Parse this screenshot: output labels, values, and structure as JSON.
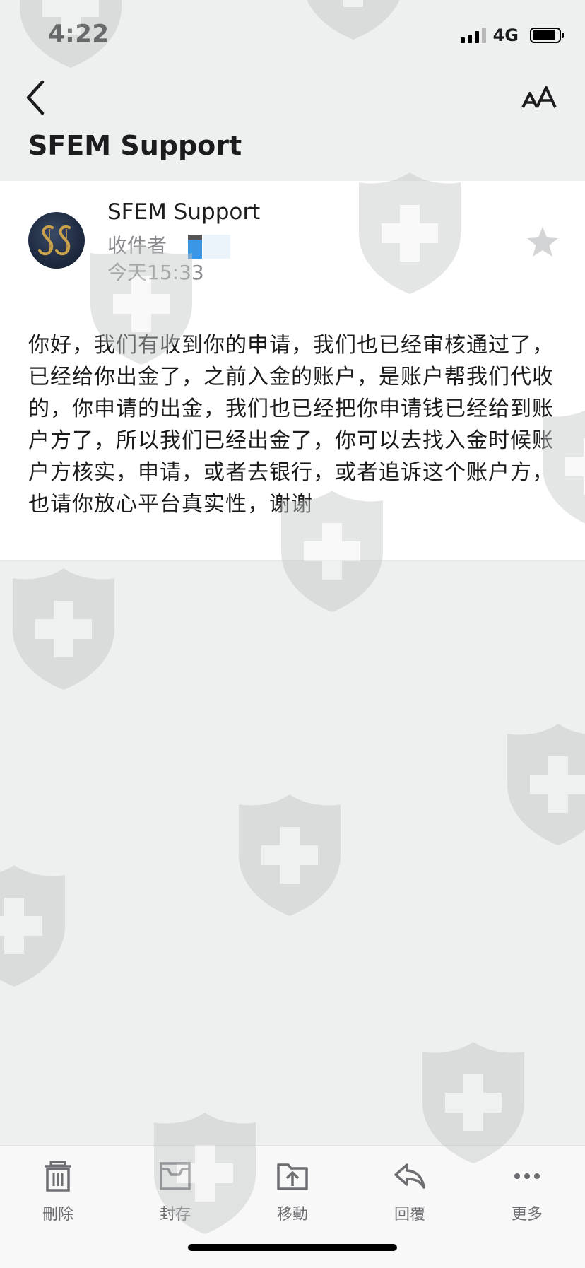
{
  "status_bar": {
    "time": "4:22",
    "network": "4G",
    "icons": [
      "signal-icon",
      "battery-icon"
    ]
  },
  "nav": {
    "back_icon": "chevron-left-icon",
    "font_size_icon": "text-size-icon",
    "title": "SFEM Support"
  },
  "message": {
    "sender": "SFEM Support",
    "recipient_label": "收件者",
    "date": "今天15:33",
    "starred": false,
    "body": "你好，我们有收到你的申请，我们也已经审核通过了，已经给你出金了，之前入金的账户，是账户帮我们代收的，你申请的出金，我们也已经把你申请钱已经给到账户方了，所以我们已经出金了，你可以去找入金时候账户方核实，申请，或者去银行，或者追诉这个账户方，也请你放心平台真实性，谢谢"
  },
  "toolbar": {
    "items": [
      {
        "label": "刪除",
        "icon": "trash-icon"
      },
      {
        "label": "封存",
        "icon": "archive-icon"
      },
      {
        "label": "移動",
        "icon": "move-folder-icon"
      },
      {
        "label": "回覆",
        "icon": "reply-icon"
      },
      {
        "label": "更多",
        "icon": "more-icon"
      }
    ]
  },
  "colors": {
    "background": "#eef0f0",
    "card": "#ffffff",
    "text_primary": "#1c1c1e",
    "text_secondary": "#8a8a8e",
    "toolbar_icon": "#6d6d72",
    "watermark": "#c9cbcb"
  }
}
